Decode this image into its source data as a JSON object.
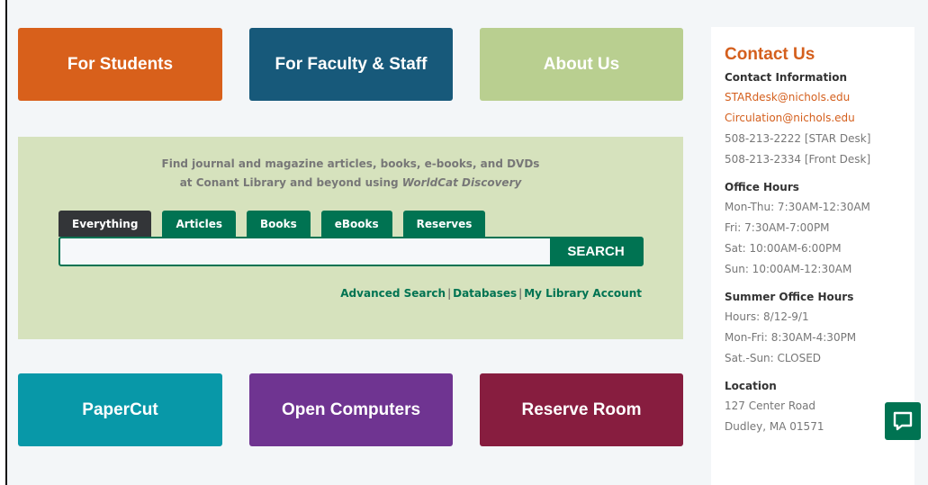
{
  "tiles_top": [
    {
      "label": "For Students",
      "color": "#d8601b"
    },
    {
      "label": "For Faculty & Staff",
      "color": "#17597a"
    },
    {
      "label": "About Us",
      "color": "#b9cf90"
    }
  ],
  "tiles_bottom": [
    {
      "label": "PaperCut",
      "color": "#0898a8"
    },
    {
      "label": "Open Computers",
      "color": "#6f3491"
    },
    {
      "label": "Reserve Room",
      "color": "#871d3f"
    }
  ],
  "search": {
    "description_line1": "Find journal and magazine articles, books, e-books, and DVDs",
    "description_line2_prefix": "at Conant Library and beyond using ",
    "description_line2_emph": "WorldCat Discovery",
    "tabs": [
      "Everything",
      "Articles",
      "Books",
      "eBooks",
      "Reserves"
    ],
    "active_tab": "Everything",
    "input_value": "",
    "button_label": "SEARCH",
    "links": [
      "Advanced Search",
      "Databases",
      "My Library Account"
    ],
    "separator": "|"
  },
  "contact": {
    "title": "Contact Us",
    "info": {
      "heading": "Contact Information",
      "emails": [
        "STARdesk@nichols.edu",
        "Circulation@nichols.edu"
      ],
      "phones": [
        "508-213-2222 [STAR Desk]",
        "508-213-2334 [Front Desk]"
      ]
    },
    "office_hours": {
      "heading": "Office Hours",
      "lines": [
        "Mon-Thu: 7:30AM-12:30AM",
        "Fri: 7:30AM-7:00PM",
        "Sat: 10:00AM-6:00PM",
        "Sun: 10:00AM-12:30AM"
      ]
    },
    "summer_hours": {
      "heading": "Summer Office Hours",
      "lines": [
        "Hours: 8/12-9/1",
        "Mon-Fri: 8:30AM-4:30PM",
        "Sat.-Sun: CLOSED"
      ]
    },
    "location": {
      "heading": "Location",
      "lines": [
        "127 Center Road",
        "Dudley, MA 01571"
      ]
    }
  },
  "chat": {
    "icon": "chat-icon",
    "color": "#007352"
  }
}
